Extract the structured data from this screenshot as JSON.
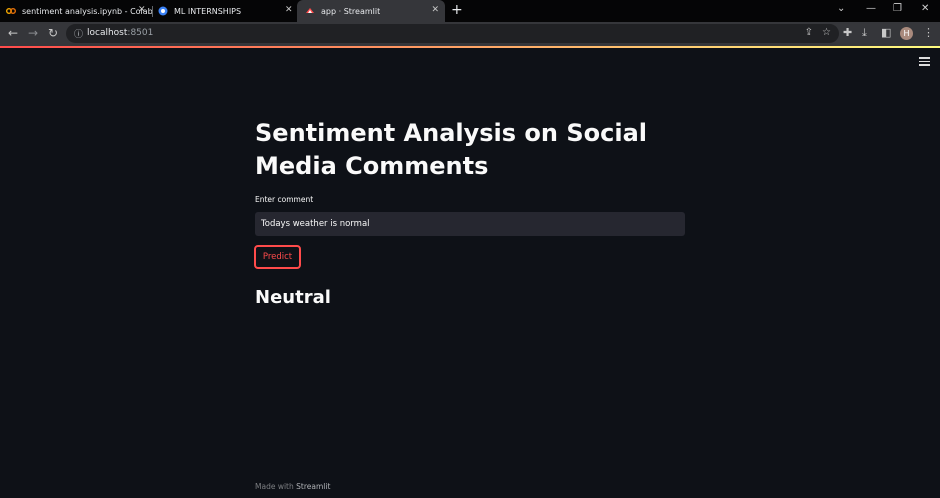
{
  "browser": {
    "tabs": [
      {
        "label": "sentiment analysis.ipynb - Colab",
        "icon": "colab-icon"
      },
      {
        "label": "ML INTERNSHIPS",
        "icon": "site-icon"
      },
      {
        "label": "app · Streamlit",
        "icon": "streamlit-icon"
      }
    ],
    "new_tab_label": "+",
    "url_host": "localhost",
    "url_port": ":8501",
    "profile_initial": "H"
  },
  "app": {
    "title": "Sentiment Analysis on Social Media Comments",
    "input_label": "Enter comment",
    "input_value": "Todays weather is normal",
    "button_label": "Predict",
    "result": "Neutral",
    "footer_prefix": "Made with",
    "footer_brand": "Streamlit"
  },
  "colors": {
    "background": "#0e1117",
    "accent": "#ff4b4b",
    "input_bg": "#262730"
  }
}
